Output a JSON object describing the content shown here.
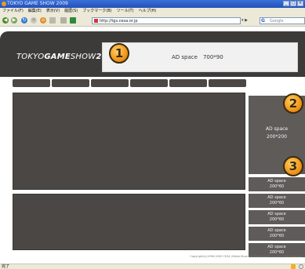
{
  "window": {
    "title": "TOKYO GAME SHOW 2009"
  },
  "menubar": {
    "items": [
      "ファイル(F)",
      "編集(E)",
      "表示(V)",
      "履歴(S)",
      "ブックマーク(B)",
      "ツール(T)",
      "ヘルプ(H)"
    ]
  },
  "toolbar": {
    "url": "http://tgs.cesa.or.jp",
    "search_placeholder": "Google"
  },
  "header": {
    "brand_tokyo": "TOKYO",
    "brand_game": "GAME",
    "brand_show": "SHOW",
    "brand_year": "2009",
    "ad_label": "AD space　700*90"
  },
  "badges": {
    "one": "1",
    "two": "2",
    "three": "3"
  },
  "sidebar": {
    "big_ad_line1": "AD space",
    "big_ad_line2": "200*200",
    "small_ads": [
      {
        "line1": "AD space",
        "line2": "200*60"
      },
      {
        "line1": "AD space",
        "line2": "200*60"
      },
      {
        "line1": "AD space",
        "line2": "200*60"
      },
      {
        "line1": "AD space",
        "line2": "200*60"
      },
      {
        "line1": "AD space",
        "line2": "200*60"
      }
    ]
  },
  "footer": {
    "copyright": "Copyright(c)1996-2009 CESA (Nikkei Business Publications,Inc.All rights reserved."
  },
  "statusbar": {
    "text": "完了"
  },
  "colors": {
    "header_bg": "#3d3b39",
    "badge": "#f29a1d",
    "content_bg": "#4a4744",
    "ad_bg": "#5e5b58"
  }
}
